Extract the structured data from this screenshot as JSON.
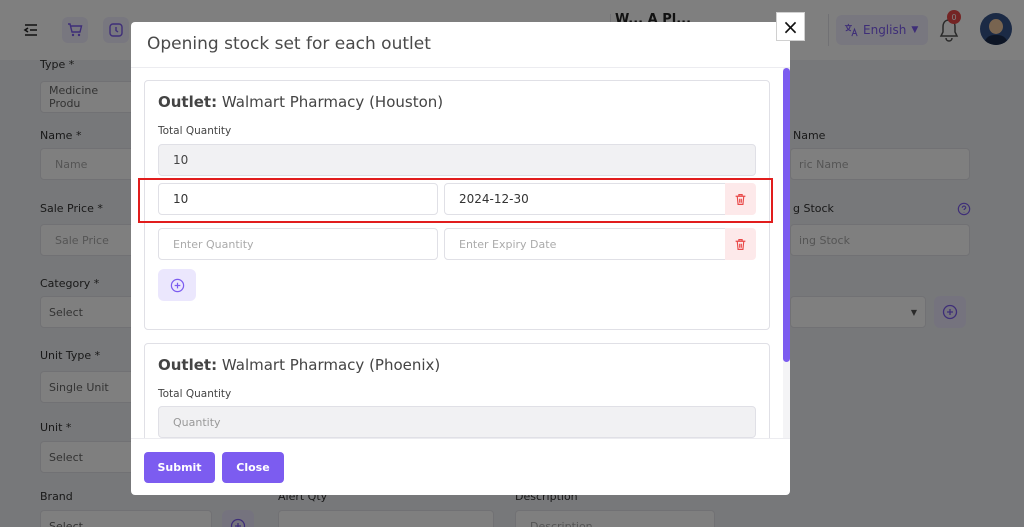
{
  "header": {
    "language": "English",
    "notification_count": "0",
    "cut_text": "W...   A Pl..."
  },
  "background_form": {
    "type_label": "Type *",
    "type_value": "Medicine Produ",
    "name_label": "Name *",
    "name_placeholder": "Name",
    "generic_label": "Name",
    "generic_placeholder": "ric Name",
    "sale_price_label": "Sale Price *",
    "sale_price_placeholder": "Sale Price",
    "opening_stock_label": "g Stock",
    "opening_stock_placeholder": "ing Stock",
    "category_label": "Category *",
    "category_value": "Select",
    "unit_type_label": "Unit Type *",
    "unit_type_value": "Single Unit",
    "unit_label": "Unit *",
    "unit_value": "Select",
    "brand_label": "Brand",
    "brand_value": "Select",
    "alert_label": "Alert Qty",
    "description_label": "Description",
    "description_placeholder": "Description"
  },
  "modal": {
    "title": "Opening stock set for each outlet",
    "close_label": "×",
    "outlets": [
      {
        "prefix": "Outlet:",
        "name": "Walmart Pharmacy (Houston)",
        "total_quantity_label": "Total Quantity",
        "total_quantity_value": "10",
        "rows": [
          {
            "quantity": "10",
            "expiry": "2024-12-30"
          },
          {
            "quantity_placeholder": "Enter Quantity",
            "expiry_placeholder": "Enter Expiry Date"
          }
        ]
      },
      {
        "prefix": "Outlet:",
        "name": "Walmart Pharmacy (Phoenix)",
        "total_quantity_label": "Total Quantity",
        "total_quantity_placeholder": "Quantity"
      }
    ],
    "submit_label": "Submit",
    "close_button_label": "Close"
  },
  "colors": {
    "accent": "#7c5cf0",
    "danger_bg": "#fde9ea",
    "danger_icon": "#e94848",
    "highlight": "#e11d1d"
  },
  "icons": [
    "menu-collapse-icon",
    "cart-icon",
    "clock-icon",
    "translate-icon",
    "bell-icon",
    "trash-icon",
    "plus-circle-icon",
    "close-icon"
  ]
}
